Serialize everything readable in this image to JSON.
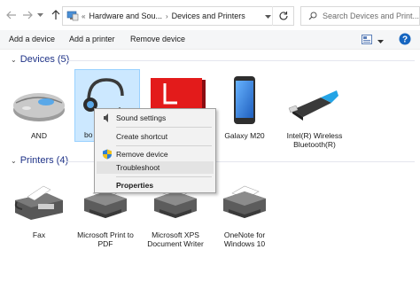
{
  "addressbar": {
    "crumbs": [
      "Hardware and Sou...",
      "Devices and Printers"
    ],
    "search_placeholder": "Search Devices and Print..."
  },
  "commandbar": {
    "add_device": "Add a device",
    "add_printer": "Add a printer",
    "remove_device": "Remove device"
  },
  "devices": {
    "header": "Devices (5)",
    "items": [
      {
        "label": "AND",
        "icon": "mouse-icon"
      },
      {
        "label": "bo",
        "icon": "headset-icon"
      },
      {
        "label": "",
        "icon": "monitor-icon"
      },
      {
        "label": "Galaxy M20",
        "icon": "phone-icon"
      },
      {
        "label": "Intel(R) Wireless Bluetooth(R)",
        "icon": "usb-adapter-icon"
      }
    ]
  },
  "printers": {
    "header": "Printers (4)",
    "items": [
      {
        "label": "Fax",
        "icon": "fax-icon"
      },
      {
        "label": "Microsoft Print to PDF",
        "icon": "printer-icon"
      },
      {
        "label": "Microsoft XPS Document Writer",
        "icon": "printer-icon"
      },
      {
        "label": "OneNote for Windows 10",
        "icon": "printer-icon"
      }
    ]
  },
  "context_menu": {
    "sound_settings": "Sound settings",
    "create_shortcut": "Create shortcut",
    "remove_device": "Remove device",
    "troubleshoot": "Troubleshoot",
    "properties": "Properties"
  },
  "colors": {
    "selection": "#cce8ff",
    "header_text": "#1e3287",
    "menu_bg": "#f2f2f2"
  }
}
